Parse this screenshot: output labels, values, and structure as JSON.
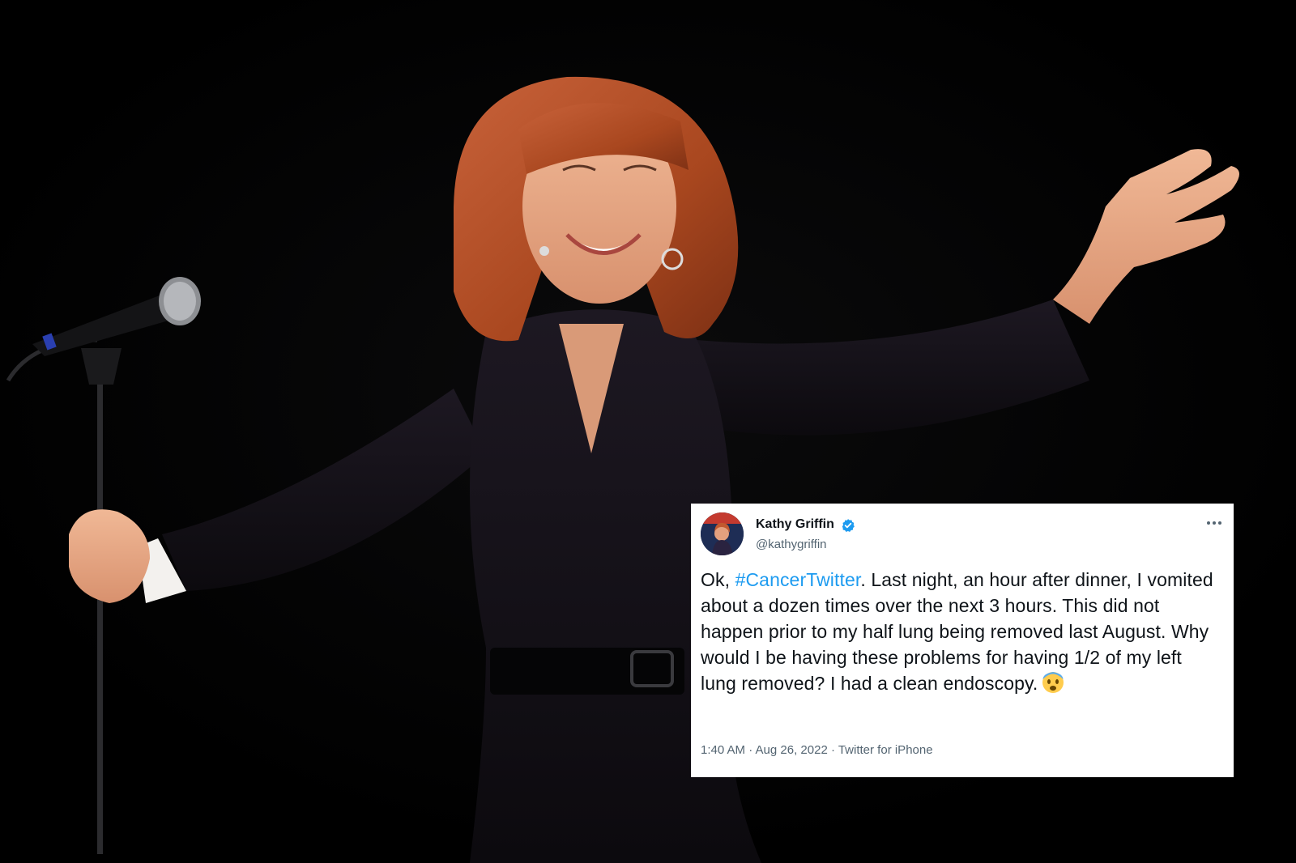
{
  "tweet": {
    "display_name": "Kathy Griffin",
    "handle": "@kathygriffin",
    "text_prefix": "Ok, ",
    "hashtag": "#CancerTwitter",
    "text_body": ". Last night, an hour after dinner, I vomited about a dozen times over the next 3 hours. This did not happen prior to my half lung being removed last August. Why would I be having these problems for having 1/2 of my left lung removed? I had a clean endoscopy.",
    "emoji": "fearful-face-icon",
    "timestamp": "1:40 AM · Aug 26, 2022 · Twitter for iPhone",
    "verified_color": "#1d9bf0",
    "hashtag_color": "#1d9bf0"
  },
  "photo": {
    "subject": "performer-on-stage",
    "background_color": "#000000",
    "hair_color": "#b5502a",
    "outfit_color": "#141018"
  }
}
